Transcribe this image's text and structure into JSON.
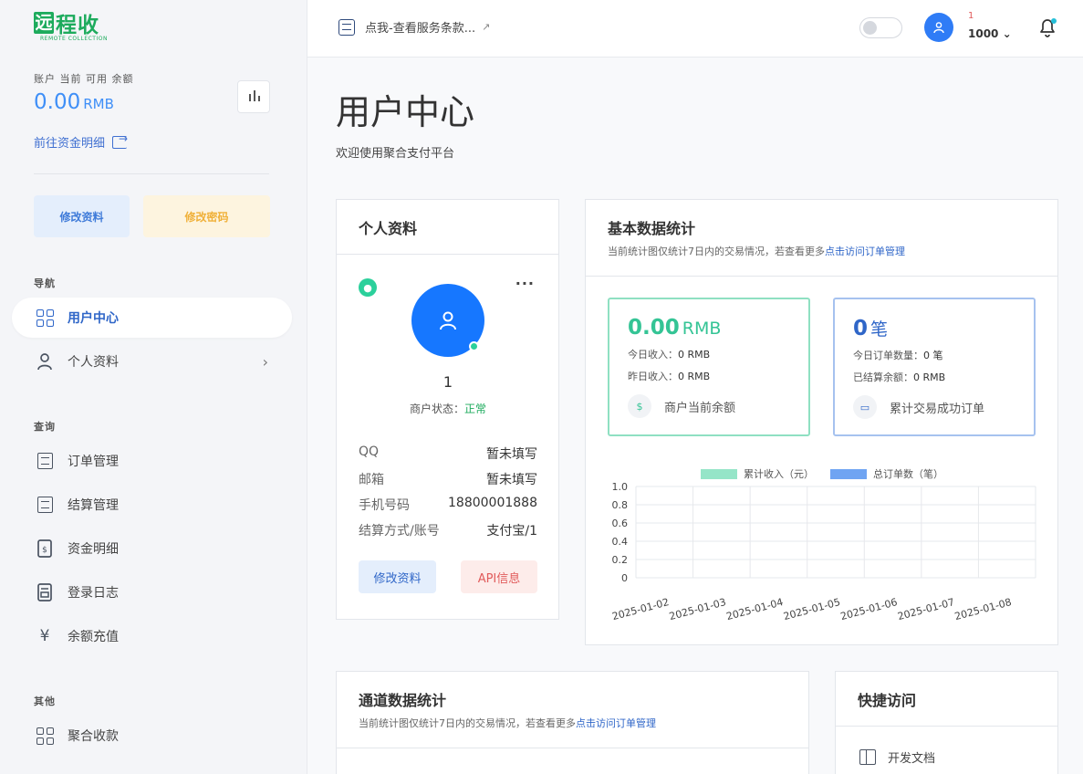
{
  "brand": {
    "name": "远程收",
    "sub": "REMOTE COLLECTION"
  },
  "sidebar": {
    "balance_label": "账户 当前 可用 余额",
    "balance_value": "0.00",
    "balance_unit": "RMB",
    "funds_link": "前往资金明细",
    "edit_profile": "修改资料",
    "change_password": "修改密码",
    "section_nav": "导航",
    "section_query": "查询",
    "section_other": "其他",
    "items": [
      {
        "label": "用户中心"
      },
      {
        "label": "个人资料"
      },
      {
        "label": "订单管理"
      },
      {
        "label": "结算管理"
      },
      {
        "label": "资金明细"
      },
      {
        "label": "登录日志"
      },
      {
        "label": "余额充值"
      },
      {
        "label": "聚合收款"
      }
    ]
  },
  "topbar": {
    "notice": "点我-查看服务条款...",
    "user_small": "1",
    "user_id": "1000"
  },
  "main": {
    "title": "用户中心",
    "subtitle": "欢迎使用聚合支付平台"
  },
  "profile": {
    "title": "个人资料",
    "name": "1",
    "status_label": "商户状态：",
    "status_value": "正常",
    "rows": [
      {
        "key": "QQ",
        "value": "暂未填写"
      },
      {
        "key": "邮箱",
        "value": "暂未填写"
      },
      {
        "key": "手机号码",
        "value": "18800001888"
      },
      {
        "key": "结算方式/账号",
        "value": "支付宝/1"
      }
    ],
    "edit_button": "修改资料",
    "api_button": "API信息"
  },
  "stats": {
    "title": "基本数据统计",
    "desc": "当前统计图仅统计7日内的交易情况，若查看更多",
    "desc_link": "点击访问订单管理",
    "income": {
      "value": "0.00",
      "unit": "RMB",
      "today_label": "今日收入：",
      "today_value": "0 RMB",
      "yesterday_label": "昨日收入：",
      "yesterday_value": "0 RMB",
      "footer": "商户当前余额"
    },
    "orders": {
      "value": "0",
      "unit": "笔",
      "today_label": "今日订单数量：",
      "today_value": "0 笔",
      "settled_label": "已结算余额：",
      "settled_value": "0 RMB",
      "footer": "累计交易成功订单"
    },
    "colors": {
      "income": "#34c495",
      "orders": "#6f9be9"
    }
  },
  "chart_data": {
    "type": "bar",
    "categories": [
      "2025-01-02",
      "2025-01-03",
      "2025-01-04",
      "2025-01-05",
      "2025-01-06",
      "2025-01-07",
      "2025-01-08"
    ],
    "series": [
      {
        "name": "累计收入（元）",
        "values": [
          0,
          0,
          0,
          0,
          0,
          0,
          0
        ],
        "color": "#95e5c8"
      },
      {
        "name": "总订单数（笔）",
        "values": [
          0,
          0,
          0,
          0,
          0,
          0,
          0
        ],
        "color": "#6fa4f2"
      }
    ],
    "yticks": [
      "1.0",
      "0.8",
      "0.6",
      "0.4",
      "0.2",
      "0"
    ],
    "ylim": [
      0,
      1
    ],
    "grid": true,
    "legend": "top"
  },
  "channel": {
    "title": "通道数据统计",
    "desc": "当前统计图仅统计7日内的交易情况，若查看更多",
    "desc_link": "点击访问订单管理"
  },
  "quick": {
    "title": "快捷访问",
    "item": "开发文档"
  }
}
